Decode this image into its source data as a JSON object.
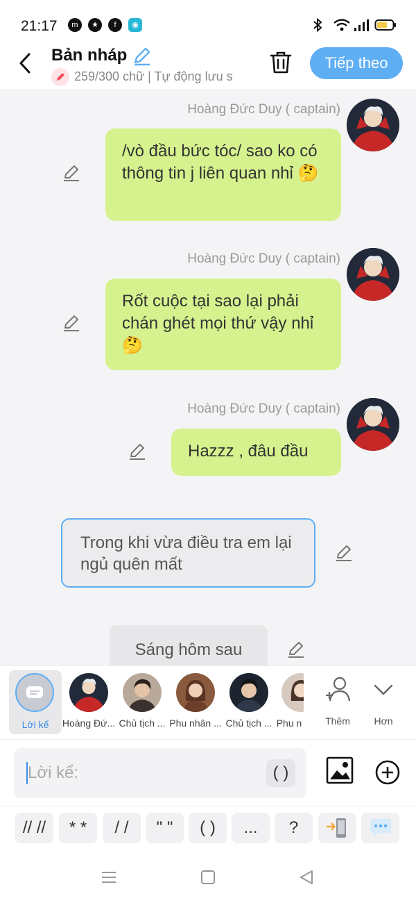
{
  "status": {
    "time": "21:17"
  },
  "header": {
    "title": "Bản nháp",
    "subtitle": "259/300 chữ | Tự động lưu s",
    "next_label": "Tiếp theo"
  },
  "messages": [
    {
      "sender": "Hoàng Đức Duy ( captain)",
      "text": "/vò đầu bức tóc/ sao ko có thông tin j liên quan nhỉ 🤔"
    },
    {
      "sender": "Hoàng Đức Duy ( captain)",
      "text": "Rốt cuộc tại sao lại phải chán ghét mọi thứ vậy nhỉ 🤔"
    },
    {
      "sender": "Hoàng Đức Duy ( captain)",
      "text": "Hazzz , đâu đầu"
    }
  ],
  "narration": {
    "text": "Trong khi vừa điều tra em lại ngủ quên mất"
  },
  "scene": {
    "text": "Sáng hôm sau"
  },
  "characters": {
    "narrator_label": "Lời kể",
    "items": [
      "Hoàng Đứ...",
      "Chủ tịch ...",
      "Phu nhân ...",
      "Chủ tịch ...",
      "Phu n"
    ],
    "add_label": "Thêm",
    "more_label": "Hơn"
  },
  "input": {
    "placeholder": "Lời kể:",
    "paren_label": "( )"
  },
  "format": {
    "items": [
      "// //",
      "* *",
      "/ /",
      "\" \"",
      "( )",
      "..."
    ],
    "question": "?"
  },
  "colors": {
    "accent": "#5eaef4",
    "bubble": "#d5f28e",
    "chat_bg": "#f4f4f6"
  }
}
